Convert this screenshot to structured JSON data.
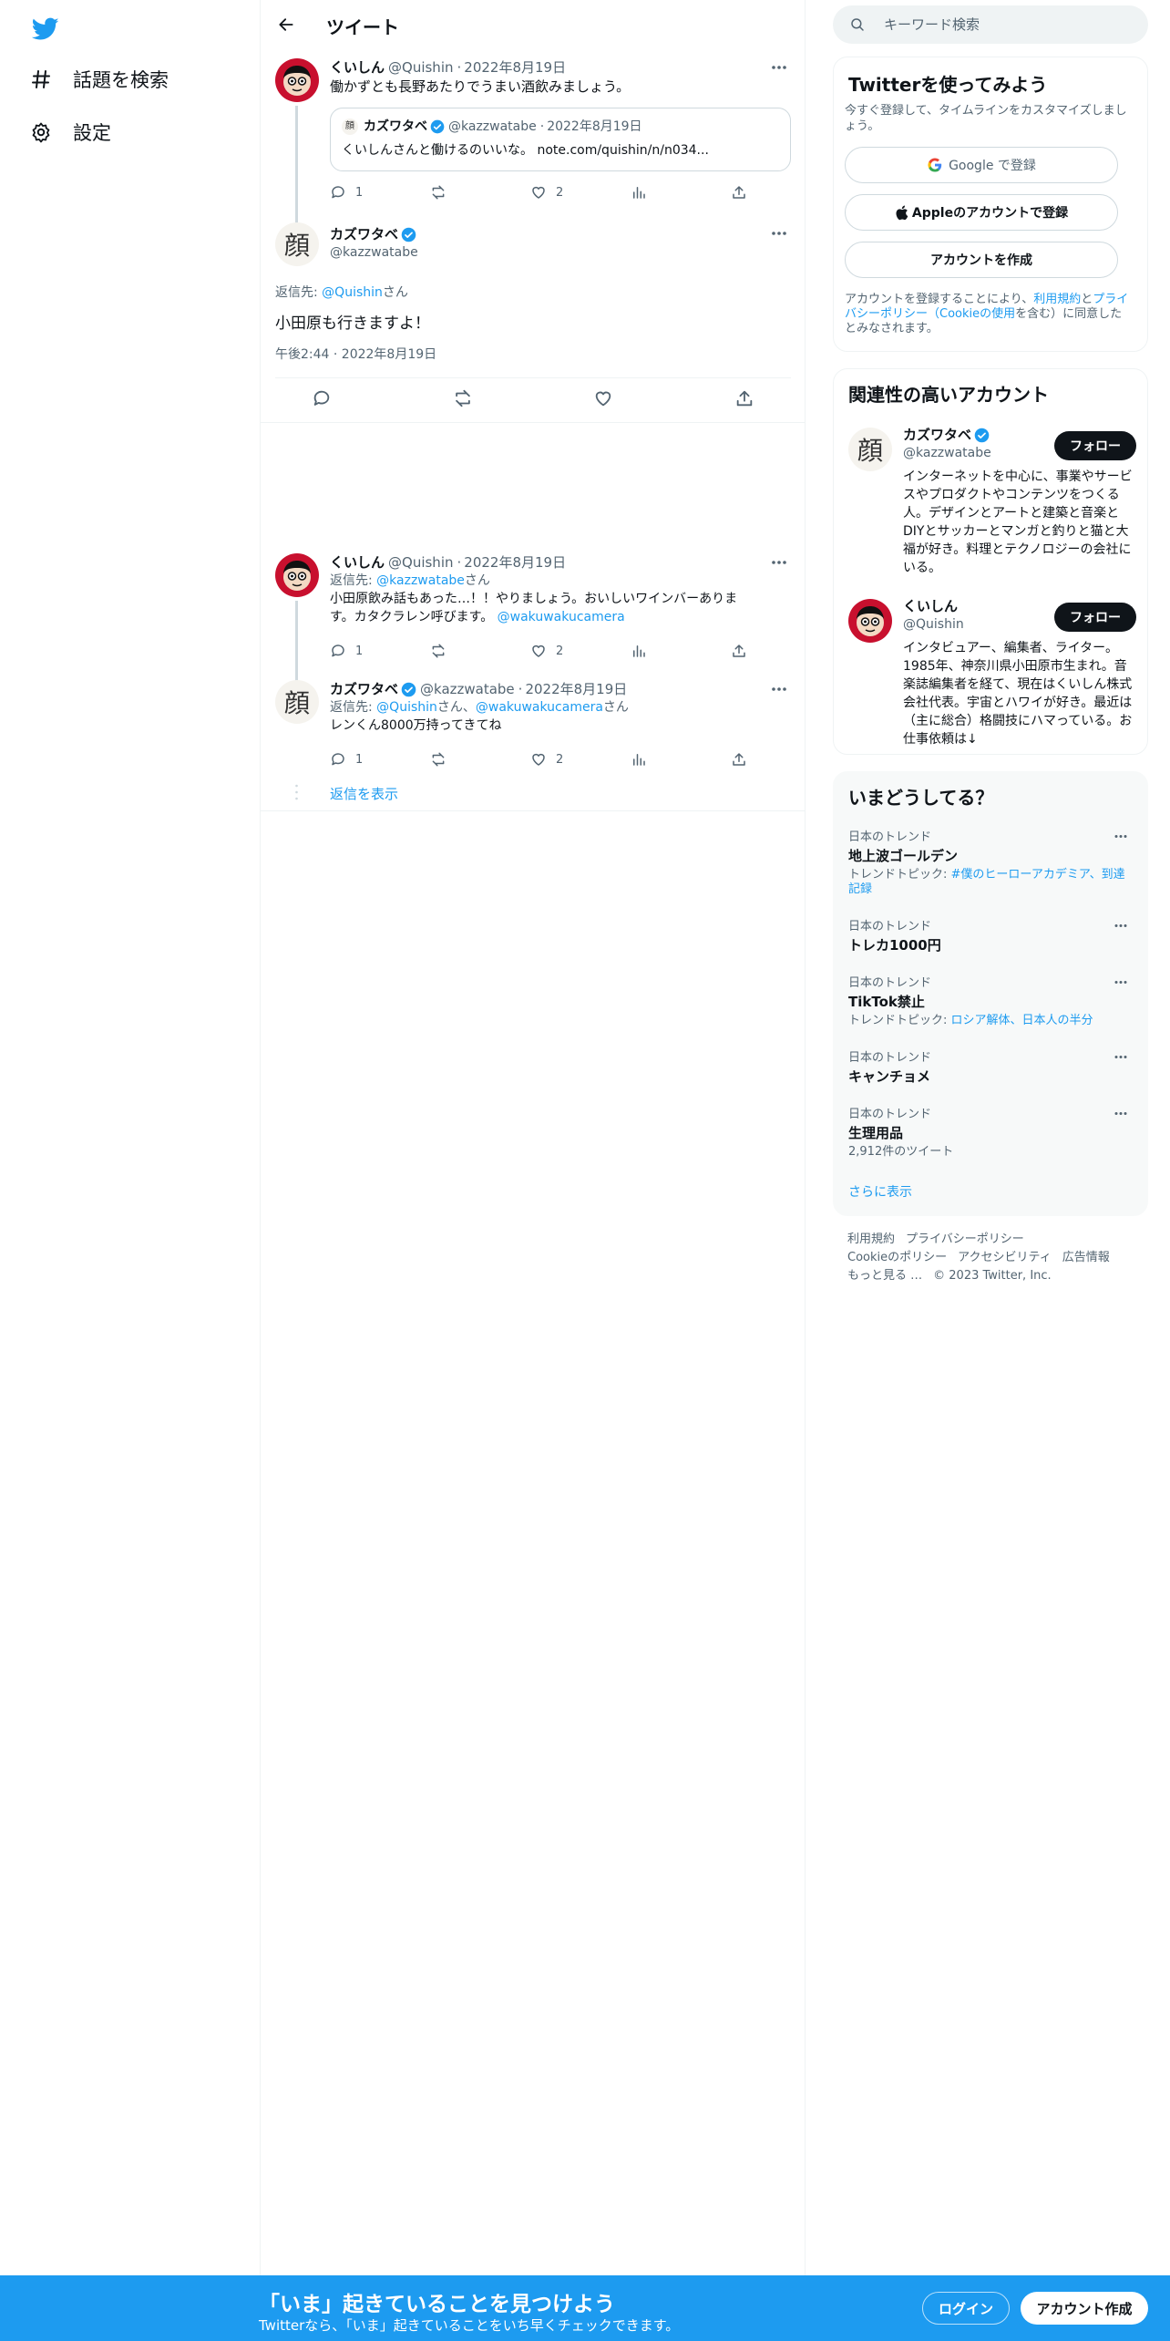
{
  "colors": {
    "accent": "#1d9bf0",
    "text": "#0f1419",
    "secondary": "#536471",
    "border": "#eff3f4"
  },
  "nav": {
    "explore_label": "話題を検索",
    "settings_label": "設定"
  },
  "header": {
    "title": "ツイート"
  },
  "thread": {
    "first": {
      "name": "くいしん",
      "handle": "@Quishin",
      "date": "2022年8月19日",
      "text": "働かずとも長野あたりでうまい酒飲みましょう。",
      "quote": {
        "name": "カズワタベ",
        "handle": "@kazzwatabe",
        "date": "2022年8月19日",
        "text": "くいしんさんと働けるのいいな。 note.com/quishin/n/n034..."
      },
      "reply_count": "1",
      "like_count": "2"
    },
    "focus": {
      "name": "カズワタベ",
      "handle": "@kazzwatabe",
      "replying_prefix": "返信先: ",
      "replying_to": "@Quishin",
      "replying_suffix": "さん",
      "text": "小田原も行きますよ！",
      "time": "午後2:44 · 2022年8月19日"
    },
    "reply1": {
      "name": "くいしん",
      "handle": "@Quishin",
      "date": "2022年8月19日",
      "replying_prefix": "返信先: ",
      "replying_to": "@kazzwatabe",
      "replying_suffix": "さん",
      "text": "小田原飲み話もあった…！！やりましょう。おいしいワインバーありま",
      "text2": "す。カタクラレン呼びます。",
      "mention": "@wakuwakucamera",
      "reply_count": "1",
      "like_count": "2"
    },
    "reply2": {
      "name": "カズワタベ",
      "handle": "@kazzwatabe",
      "date": "2022年8月19日",
      "replying_prefix": "返信先: ",
      "replying_to": "@Quishin",
      "replying_mid": "さん、",
      "replying_to2": "@wakuwakucamera",
      "replying_suffix": "さん",
      "text": "レンくん8000万持ってきてね",
      "reply_count": "1",
      "like_count": "2"
    },
    "show_replies": "返信を表示"
  },
  "avatar_glyph": "顔",
  "search": {
    "placeholder": "キーワード検索"
  },
  "signup_card": {
    "title": "Twitterを使ってみよう",
    "subtitle": "今すぐ登録して、タイムラインをカスタマイズしましょう。",
    "google_label": "Google で登録",
    "apple_label": "Appleのアカウントで登録",
    "create_label": "アカウントを作成",
    "legal_1": "アカウントを登録することにより、",
    "legal_link1": "利用規約",
    "legal_2": "と",
    "legal_link2": "プライバシーポリシー（Cookieの使用",
    "legal_3": "を含む）に同意したとみなされます。"
  },
  "related": {
    "title": "関連性の高いアカウント",
    "accounts": [
      {
        "name": "カズワタベ",
        "handle": "@kazzwatabe",
        "follow": "フォロー",
        "bio": "インターネットを中心に、事業やサービスやプロダクトやコンテンツをつくる人。デザインとアートと建築と音楽とDIYとサッカーとマンガと釣りと猫と大福が好き。料理とテクノロジーの会社にいる。"
      },
      {
        "name": "くいしん",
        "handle": "@Quishin",
        "follow": "フォロー",
        "bio": "インタビュアー、編集者、ライター。1985年、神奈川県小田原市生まれ。音楽誌編集者を経て、現在はくいしん株式会社代表。宇宙とハワイが好き。最近は（主に総合）格闘技にハマっている。お仕事依頼は↓"
      }
    ]
  },
  "trends": {
    "title": "いまどうしてる？",
    "items": [
      {
        "context": "日本のトレンド",
        "name": "地上波ゴールデン",
        "sub_prefix": "トレンドトピック: ",
        "sub_link": "#僕のヒーローアカデミア、到達記録"
      },
      {
        "context": "日本のトレンド",
        "name": "トレカ1000円"
      },
      {
        "context": "日本のトレンド",
        "name": "TikTok禁止",
        "sub_prefix": "トレンドトピック: ",
        "sub_link": "ロシア解体、日本人の半分"
      },
      {
        "context": "日本のトレンド",
        "name": "キャンチョメ"
      },
      {
        "context": "日本のトレンド",
        "name": "生理用品",
        "sub_plain": "2,912件のツイート"
      }
    ],
    "show_more": "さらに表示"
  },
  "footer": {
    "links1": [
      "利用規約",
      "プライバシーポリシー"
    ],
    "links2": [
      "Cookieのポリシー",
      "アクセシビリティ",
      "広告情報"
    ],
    "more": "もっと見る …",
    "copyright": "© 2023 Twitter, Inc."
  },
  "banner": {
    "headline": "「いま」起きていることを見つけよう",
    "subline": "Twitterなら、「いま」起きていることをいち早くチェックできます。",
    "login": "ログイン",
    "signup": "アカウント作成"
  }
}
